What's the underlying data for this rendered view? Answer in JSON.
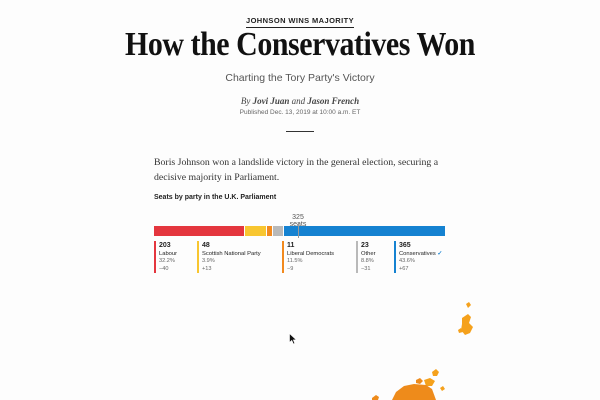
{
  "article": {
    "kicker": "JOHNSON WINS MAJORITY",
    "headline": "How the Conservatives Won",
    "subhead": "Charting the Tory Party's Victory",
    "byline_prefix": "By",
    "author1": "Jovi Juan",
    "byline_and": "and",
    "author2": "Jason French",
    "published": "Published Dec. 13, 2019 at 10:00 a.m. ET",
    "lede": "Boris Johnson won a landslide victory in the general election, securing a decisive majority in Parliament."
  },
  "chart_data": {
    "type": "bar",
    "title": "Seats by party in the U.K. Parliament",
    "majority_label": "325 seats",
    "categories": [
      "Labour",
      "Scottish National Party",
      "Liberal Democrats",
      "Other",
      "Conservatives"
    ],
    "values": [
      203,
      48,
      11,
      23,
      365
    ],
    "vote_share": [
      "32.2%",
      "3.9%",
      "11.5%",
      "8.8%",
      "43.6%"
    ],
    "change": [
      "−40",
      "+13",
      "−9",
      "−31",
      "+67"
    ],
    "colors": [
      "#e4363e",
      "#f8c630",
      "#f28a1e",
      "#b9b9b9",
      "#1582d1"
    ],
    "winner_mark": "✓"
  }
}
